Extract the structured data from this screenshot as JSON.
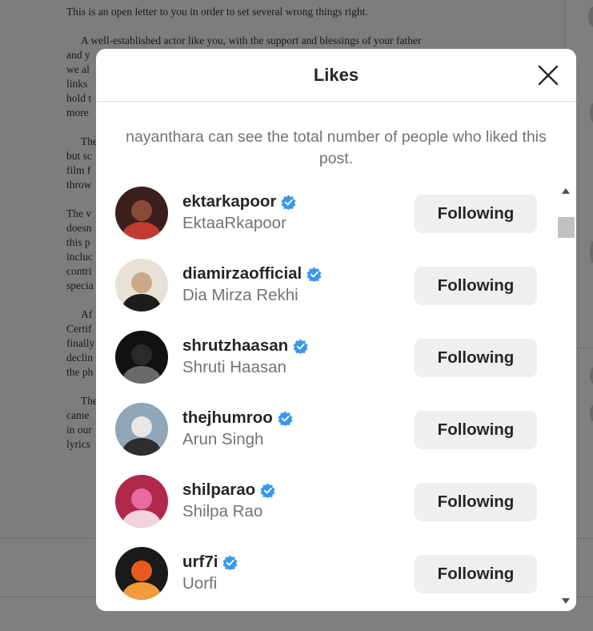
{
  "background_document": {
    "paragraphs": [
      {
        "indent": false,
        "lines": [
          "This is an open letter to you in order to set several wrong things right."
        ]
      },
      {
        "indent": true,
        "lines": [
          "A well-established actor like you, with the support and blessings of your father",
          "and y",
          "we al",
          "links",
          "hold t",
          "more"
        ]
      },
      {
        "indent": true,
        "lines": [
          "The",
          "but sc",
          "film f",
          "throw"
        ]
      },
      {
        "indent": false,
        "lines": [
          "The v",
          "doesn",
          "this p",
          "incluc",
          "contri",
          "specia"
        ]
      },
      {
        "indent": true,
        "lines": [
          "Af",
          "Certif",
          "finally",
          "declin",
          "the ph"
        ]
      },
      {
        "indent": true,
        "lines": [
          "The",
          "came",
          "in our",
          "lyrics"
        ]
      }
    ]
  },
  "modal": {
    "title": "Likes",
    "close_icon": "close-icon",
    "notice": "nayanthara can see the total number of people who liked this post."
  },
  "likes": [
    {
      "username": "ektarkapoor",
      "full_name": "EktaaRkapoor",
      "verified": true,
      "button": "Following",
      "avatar_colors": [
        "#3a1f1c",
        "#8a4a3a",
        "#c23a30"
      ]
    },
    {
      "username": "diamirzaofficial",
      "full_name": "Dia Mirza Rekhi",
      "verified": true,
      "button": "Following",
      "avatar_colors": [
        "#e8e2d6",
        "#caa98a",
        "#1c1c1c"
      ]
    },
    {
      "username": "shrutzhaasan",
      "full_name": "Shruti Haasan",
      "verified": true,
      "button": "Following",
      "avatar_colors": [
        "#111111",
        "#2a2a2a",
        "#6a6a6a"
      ]
    },
    {
      "username": "thejhumroo",
      "full_name": "Arun Singh",
      "verified": true,
      "button": "Following",
      "avatar_colors": [
        "#8fa7b8",
        "#e8e8e8",
        "#2e2e2e"
      ]
    },
    {
      "username": "shilparao",
      "full_name": "Shilpa Rao",
      "verified": true,
      "button": "Following",
      "avatar_colors": [
        "#b0284a",
        "#e86aa0",
        "#f2d4dc"
      ]
    },
    {
      "username": "urf7i",
      "full_name": "Uorfi",
      "verified": true,
      "button": "Following",
      "avatar_colors": [
        "#1a1a1a",
        "#e85a1a",
        "#f39a3a"
      ]
    }
  ],
  "colors": {
    "overlay": "#7d7d7d",
    "verified_badge": "#3897f0",
    "button_bg": "#efefef",
    "primary_text": "#262626",
    "secondary_text": "#737373"
  }
}
